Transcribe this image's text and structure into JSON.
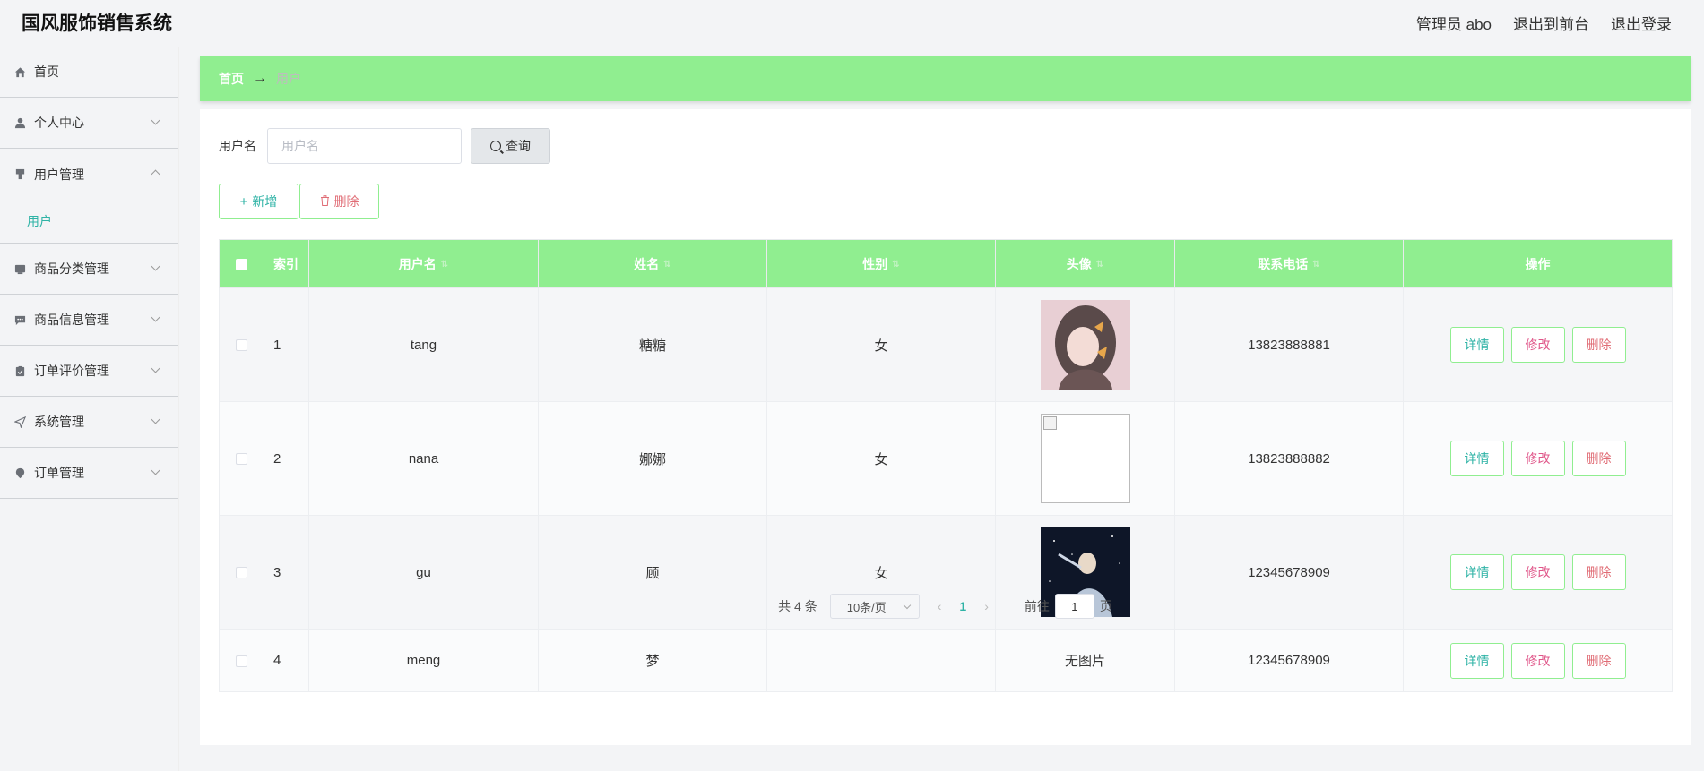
{
  "header": {
    "title": "国风服饰销售系统",
    "admin": "管理员 abo",
    "back_to_front": "退出到前台",
    "logout": "退出登录"
  },
  "sidebar": {
    "items": [
      {
        "label": "首页",
        "icon": "home-icon"
      },
      {
        "label": "个人中心",
        "icon": "user-icon"
      },
      {
        "label": "用户管理",
        "icon": "pin-icon",
        "expanded": true
      },
      {
        "label": "商品分类管理",
        "icon": "folder-icon"
      },
      {
        "label": "商品信息管理",
        "icon": "message-icon"
      },
      {
        "label": "订单评价管理",
        "icon": "clipboard-icon"
      },
      {
        "label": "系统管理",
        "icon": "send-icon"
      },
      {
        "label": "订单管理",
        "icon": "location-icon"
      }
    ],
    "submenu_user": "用户"
  },
  "breadcrumb": {
    "home": "首页",
    "sep": "→",
    "current": "用户"
  },
  "search": {
    "label": "用户名",
    "placeholder": "用户名",
    "button": "查询"
  },
  "actions": {
    "add": "新增",
    "delete": "删除"
  },
  "table": {
    "headers": {
      "index": "索引",
      "username": "用户名",
      "name": "姓名",
      "gender": "性别",
      "avatar": "头像",
      "phone": "联系电话",
      "ops": "操作"
    },
    "rows": [
      {
        "index": "1",
        "username": "tang",
        "name": "糖糖",
        "gender": "女",
        "avatar": "image",
        "phone": "13823888881"
      },
      {
        "index": "2",
        "username": "nana",
        "name": "娜娜",
        "gender": "女",
        "avatar": "broken",
        "phone": "13823888882"
      },
      {
        "index": "3",
        "username": "gu",
        "name": "顾",
        "gender": "女",
        "avatar": "image",
        "phone": "12345678909"
      },
      {
        "index": "4",
        "username": "meng",
        "name": "梦",
        "gender": "",
        "avatar_text": "无图片",
        "phone": "12345678909"
      }
    ],
    "op_labels": {
      "detail": "详情",
      "edit": "修改",
      "delete": "删除"
    }
  },
  "pagination": {
    "total": "共 4 条",
    "page_size": "10条/页",
    "prev": "‹",
    "current_page": "1",
    "next": "›",
    "goto_prefix": "前往",
    "goto_value": "1",
    "goto_suffix": "页"
  },
  "colors": {
    "accent_green": "#90ee90",
    "teal_text": "#2fb3a6",
    "delete_text": "#e06c75"
  }
}
